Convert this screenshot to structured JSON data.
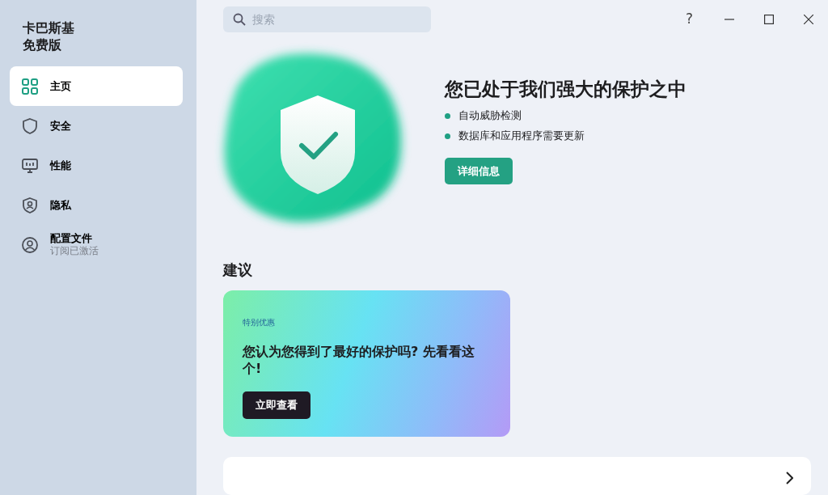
{
  "app": {
    "title_lines": [
      "卡巴斯基",
      "免费版"
    ]
  },
  "sidebar": {
    "items": [
      {
        "label": "主页",
        "selected": true
      },
      {
        "label": "安全",
        "selected": false
      },
      {
        "label": "性能",
        "selected": false
      },
      {
        "label": "隐私",
        "selected": false
      },
      {
        "label": "配置文件",
        "subtitle": "订阅已激活",
        "selected": false
      }
    ]
  },
  "search": {
    "placeholder": "搜索"
  },
  "window_controls": {
    "help": "?"
  },
  "status": {
    "title": "您已处于我们强大的保护之中",
    "bullets": [
      "自动威胁检测",
      "数据库和应用程序需要更新"
    ],
    "button": "详细信息"
  },
  "recommendations": {
    "heading": "建议",
    "offer": {
      "tag": "特别优惠",
      "title": "您认为您得到了最好的保护吗? 先看看这个!",
      "button": "立即查看"
    }
  }
}
